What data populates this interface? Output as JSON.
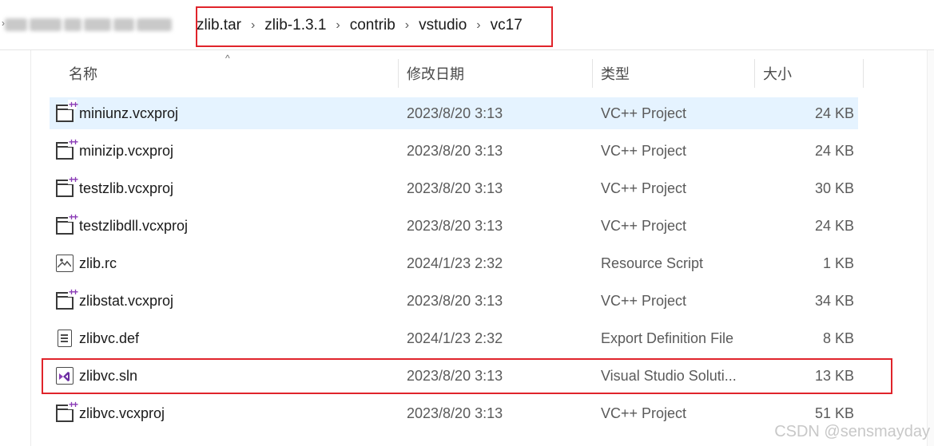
{
  "breadcrumb": {
    "obscured_prefix": "",
    "items": [
      "zlib.tar",
      "zlib-1.3.1",
      "contrib",
      "vstudio",
      "vc17"
    ],
    "separator": "›"
  },
  "columns": {
    "name": "名称",
    "date": "修改日期",
    "type": "类型",
    "size": "大小"
  },
  "files": [
    {
      "name": "miniunz.vcxproj",
      "date": "2023/8/20 3:13",
      "type": "VC++ Project",
      "size": "24 KB",
      "icon": "vcxproj-icon",
      "selected": true
    },
    {
      "name": "minizip.vcxproj",
      "date": "2023/8/20 3:13",
      "type": "VC++ Project",
      "size": "24 KB",
      "icon": "vcxproj-icon"
    },
    {
      "name": "testzlib.vcxproj",
      "date": "2023/8/20 3:13",
      "type": "VC++ Project",
      "size": "30 KB",
      "icon": "vcxproj-icon"
    },
    {
      "name": "testzlibdll.vcxproj",
      "date": "2023/8/20 3:13",
      "type": "VC++ Project",
      "size": "24 KB",
      "icon": "vcxproj-icon"
    },
    {
      "name": "zlib.rc",
      "date": "2024/1/23 2:32",
      "type": "Resource Script",
      "size": "1 KB",
      "icon": "image-file-icon"
    },
    {
      "name": "zlibstat.vcxproj",
      "date": "2023/8/20 3:13",
      "type": "VC++ Project",
      "size": "34 KB",
      "icon": "vcxproj-icon"
    },
    {
      "name": "zlibvc.def",
      "date": "2024/1/23 2:32",
      "type": "Export Definition File",
      "size": "8 KB",
      "icon": "text-document-icon"
    },
    {
      "name": "zlibvc.sln",
      "date": "2023/8/20 3:13",
      "type": "Visual Studio Soluti...",
      "size": "13 KB",
      "icon": "visual-studio-solution-icon",
      "highlighted": true
    },
    {
      "name": "zlibvc.vcxproj",
      "date": "2023/8/20 3:13",
      "type": "VC++ Project",
      "size": "51 KB",
      "icon": "vcxproj-icon"
    }
  ],
  "watermark": "CSDN @sensmayday",
  "colors": {
    "highlight_border": "#e0242b",
    "selected_row": "#e5f3ff",
    "vs_purple": "#8a3bb6"
  }
}
